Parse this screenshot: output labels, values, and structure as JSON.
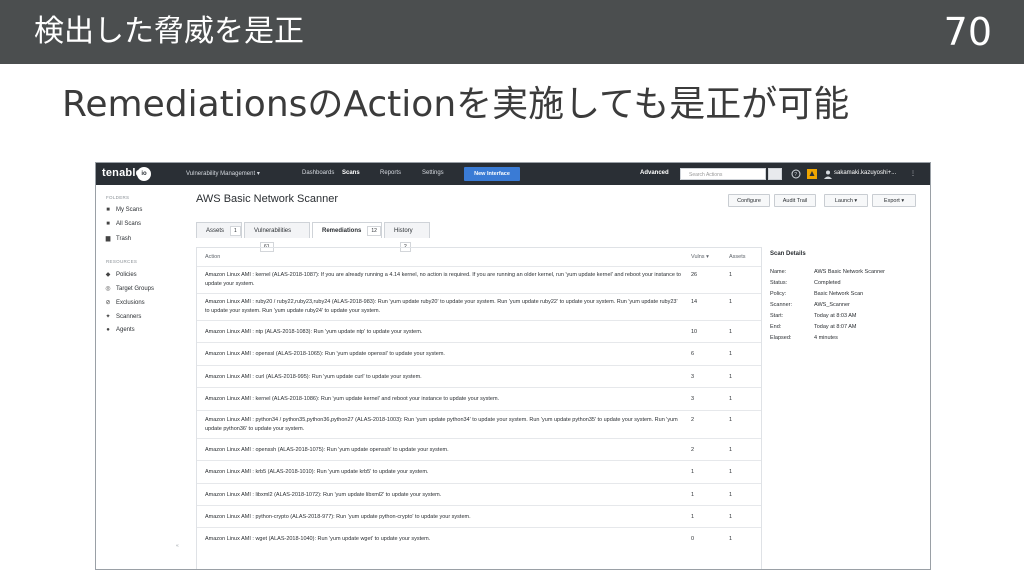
{
  "slide": {
    "title": "検出した脅威を是正",
    "number": "70",
    "subtitle": "RemediationsのActionを実施しても是正が可能"
  },
  "topbar": {
    "logo": "tenable",
    "logo_badge": "io",
    "nav": [
      "Vulnerability Management ▾",
      "Dashboards",
      "Scans",
      "Reports",
      "Settings"
    ],
    "active_nav": "Scans",
    "new_interface": "New Interface",
    "advanced": "Advanced",
    "search_placeholder": "Search Actions",
    "user": "sakamaki.kazuyoshi+..."
  },
  "sidebar": {
    "folders_heading": "FOLDERS",
    "folders": [
      {
        "icon": "folder-icon",
        "label": "My Scans"
      },
      {
        "icon": "folder-icon",
        "label": "All Scans"
      },
      {
        "icon": "trash-icon",
        "label": "Trash"
      }
    ],
    "resources_heading": "RESOURCES",
    "resources": [
      {
        "icon": "shield-icon",
        "label": "Policies"
      },
      {
        "icon": "target-icon",
        "label": "Target Groups"
      },
      {
        "icon": "exclusion-icon",
        "label": "Exclusions"
      },
      {
        "icon": "scanner-icon",
        "label": "Scanners"
      },
      {
        "icon": "agent-icon",
        "label": "Agents"
      }
    ],
    "collapse": "«"
  },
  "main": {
    "page_title": "AWS Basic Network Scanner",
    "buttons": {
      "configure": "Configure",
      "audit_trail": "Audit Trail",
      "launch": "Launch ▾",
      "export": "Export ▾"
    },
    "tabs": [
      {
        "label": "Assets",
        "count": "1"
      },
      {
        "label": "Vulnerabilities",
        "count": "61"
      },
      {
        "label": "Remediations",
        "count": "12"
      },
      {
        "label": "History",
        "count": "2"
      }
    ],
    "active_tab": "Remediations",
    "table": {
      "headers": {
        "action": "Action",
        "vulns": "Vulns ▾",
        "assets": "Assets"
      },
      "rows": [
        {
          "action": "Amazon Linux AMI : kernel (ALAS-2018-1087): If you are already running a 4.14 kernel, no action is required. If you are running an older kernel, run 'yum update kernel' and reboot your instance to update your system.",
          "vulns": "26",
          "assets": "1"
        },
        {
          "action": "Amazon Linux AMI : ruby20 / ruby22,ruby23,ruby24 (ALAS-2018-983): Run 'yum update ruby20' to update your system. Run 'yum update ruby22' to update your system. Run 'yum update ruby23' to update your system. Run 'yum update ruby24' to update your system.",
          "vulns": "14",
          "assets": "1"
        },
        {
          "action": "Amazon Linux AMI : ntp (ALAS-2018-1083): Run 'yum update ntp' to update your system.",
          "vulns": "10",
          "assets": "1"
        },
        {
          "action": "Amazon Linux AMI : openssl (ALAS-2018-1065): Run 'yum update openssl' to update your system.",
          "vulns": "6",
          "assets": "1"
        },
        {
          "action": "Amazon Linux AMI : curl (ALAS-2018-995): Run 'yum update curl' to update your system.",
          "vulns": "3",
          "assets": "1"
        },
        {
          "action": "Amazon Linux AMI : kernel (ALAS-2018-1086): Run 'yum update kernel' and reboot your instance to update your system.",
          "vulns": "3",
          "assets": "1"
        },
        {
          "action": "Amazon Linux AMI : python34 / python35,python36,python27 (ALAS-2018-1003): Run 'yum update python34' to update your system. Run 'yum update python35' to update your system. Run 'yum update python36' to update your system.",
          "vulns": "2",
          "assets": "1"
        },
        {
          "action": "Amazon Linux AMI : openssh (ALAS-2018-1075): Run 'yum update openssh' to update your system.",
          "vulns": "2",
          "assets": "1"
        },
        {
          "action": "Amazon Linux AMI : krb5 (ALAS-2018-1010): Run 'yum update krb5' to update your system.",
          "vulns": "1",
          "assets": "1"
        },
        {
          "action": "Amazon Linux AMI : libxml2 (ALAS-2018-1072): Run 'yum update libxml2' to update your system.",
          "vulns": "1",
          "assets": "1"
        },
        {
          "action": "Amazon Linux AMI : python-crypto (ALAS-2018-977): Run 'yum update python-crypto' to update your system.",
          "vulns": "1",
          "assets": "1"
        },
        {
          "action": "Amazon Linux AMI : wget (ALAS-2018-1040): Run 'yum update wget' to update your system.",
          "vulns": "0",
          "assets": "1"
        }
      ]
    },
    "details": {
      "title": "Scan Details",
      "items": [
        {
          "label": "Name:",
          "value": "AWS Basic Network Scanner"
        },
        {
          "label": "Status:",
          "value": "Completed"
        },
        {
          "label": "Policy:",
          "value": "Basic Network Scan"
        },
        {
          "label": "Scanner:",
          "value": "AWS_Scanner"
        },
        {
          "label": "Start:",
          "value": "Today at 8:03 AM"
        },
        {
          "label": "End:",
          "value": "Today at 8:07 AM"
        },
        {
          "label": "Elapsed:",
          "value": "4 minutes"
        }
      ]
    }
  }
}
